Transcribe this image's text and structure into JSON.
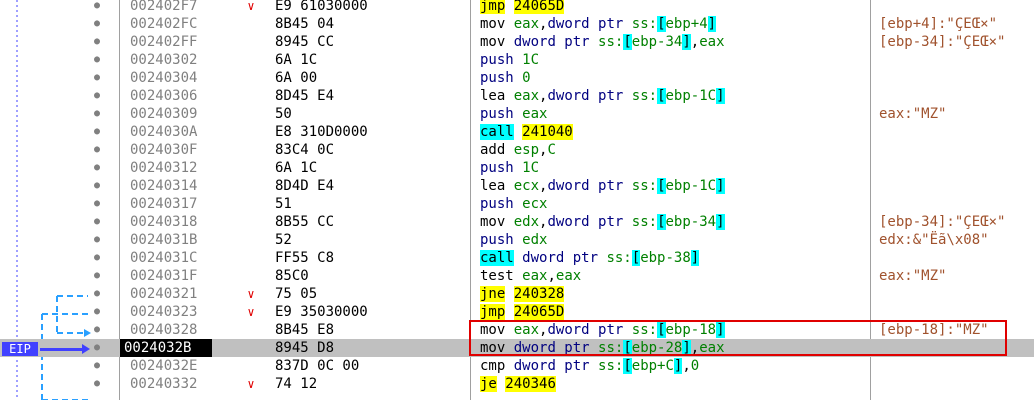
{
  "eip_label": "EIP",
  "rows": [
    {
      "addr": "002402F7",
      "arrow": "∨",
      "bytes": "E9 61030000",
      "mn": "jmp",
      "mn_kind": "jmp",
      "ops": [
        {
          "t": "24065D",
          "k": "jmpaddr"
        }
      ],
      "comment": ""
    },
    {
      "addr": "002402FC",
      "arrow": "",
      "bytes": "8B45 04",
      "mn": "mov",
      "mn_kind": "",
      "ops": [
        {
          "t": "eax",
          "k": "reg"
        },
        {
          "t": ",",
          "k": ""
        },
        {
          "t": "dword ptr ",
          "k": "kw"
        },
        {
          "t": "ss:",
          "k": "reg"
        },
        {
          "t": "[",
          "k": "br"
        },
        {
          "t": "ebp+4",
          "k": "reg"
        },
        {
          "t": "]",
          "k": "br"
        }
      ],
      "comment": "[ebp+4]:\"ÇEŒ×\""
    },
    {
      "addr": "002402FF",
      "arrow": "",
      "bytes": "8945 CC",
      "mn": "mov",
      "mn_kind": "",
      "ops": [
        {
          "t": "dword ptr ",
          "k": "kw"
        },
        {
          "t": "ss:",
          "k": "reg"
        },
        {
          "t": "[",
          "k": "br"
        },
        {
          "t": "ebp-34",
          "k": "reg"
        },
        {
          "t": "]",
          "k": "br"
        },
        {
          "t": ",",
          "k": ""
        },
        {
          "t": "eax",
          "k": "reg"
        }
      ],
      "comment": "[ebp-34]:\"ÇEŒ×\""
    },
    {
      "addr": "00240302",
      "arrow": "",
      "bytes": "6A 1C",
      "mn": "push",
      "mn_kind": "push",
      "ops": [
        {
          "t": "1C",
          "k": "num"
        }
      ],
      "comment": ""
    },
    {
      "addr": "00240304",
      "arrow": "",
      "bytes": "6A 00",
      "mn": "push",
      "mn_kind": "push",
      "ops": [
        {
          "t": "0",
          "k": "num"
        }
      ],
      "comment": ""
    },
    {
      "addr": "00240306",
      "arrow": "",
      "bytes": "8D45 E4",
      "mn": "lea",
      "mn_kind": "",
      "ops": [
        {
          "t": "eax",
          "k": "reg"
        },
        {
          "t": ",",
          "k": ""
        },
        {
          "t": "dword ptr ",
          "k": "kw"
        },
        {
          "t": "ss:",
          "k": "reg"
        },
        {
          "t": "[",
          "k": "br"
        },
        {
          "t": "ebp-1C",
          "k": "reg"
        },
        {
          "t": "]",
          "k": "br"
        }
      ],
      "comment": ""
    },
    {
      "addr": "00240309",
      "arrow": "",
      "bytes": "50",
      "mn": "push",
      "mn_kind": "push",
      "ops": [
        {
          "t": "eax",
          "k": "reg"
        }
      ],
      "comment": "eax:\"MZ\""
    },
    {
      "addr": "0024030A",
      "arrow": "",
      "bytes": "E8 310D0000",
      "mn": "call",
      "mn_kind": "call",
      "ops": [
        {
          "t": "241040",
          "k": "jmpaddr"
        }
      ],
      "comment": ""
    },
    {
      "addr": "0024030F",
      "arrow": "",
      "bytes": "83C4 0C",
      "mn": "add",
      "mn_kind": "",
      "ops": [
        {
          "t": "esp",
          "k": "reg"
        },
        {
          "t": ",",
          "k": ""
        },
        {
          "t": "C",
          "k": "num"
        }
      ],
      "comment": ""
    },
    {
      "addr": "00240312",
      "arrow": "",
      "bytes": "6A 1C",
      "mn": "push",
      "mn_kind": "push",
      "ops": [
        {
          "t": "1C",
          "k": "num"
        }
      ],
      "comment": ""
    },
    {
      "addr": "00240314",
      "arrow": "",
      "bytes": "8D4D E4",
      "mn": "lea",
      "mn_kind": "",
      "ops": [
        {
          "t": "ecx",
          "k": "reg"
        },
        {
          "t": ",",
          "k": ""
        },
        {
          "t": "dword ptr ",
          "k": "kw"
        },
        {
          "t": "ss:",
          "k": "reg"
        },
        {
          "t": "[",
          "k": "br"
        },
        {
          "t": "ebp-1C",
          "k": "reg"
        },
        {
          "t": "]",
          "k": "br"
        }
      ],
      "comment": ""
    },
    {
      "addr": "00240317",
      "arrow": "",
      "bytes": "51",
      "mn": "push",
      "mn_kind": "push",
      "ops": [
        {
          "t": "ecx",
          "k": "reg"
        }
      ],
      "comment": ""
    },
    {
      "addr": "00240318",
      "arrow": "",
      "bytes": "8B55 CC",
      "mn": "mov",
      "mn_kind": "",
      "ops": [
        {
          "t": "edx",
          "k": "reg"
        },
        {
          "t": ",",
          "k": ""
        },
        {
          "t": "dword ptr ",
          "k": "kw"
        },
        {
          "t": "ss:",
          "k": "reg"
        },
        {
          "t": "[",
          "k": "br"
        },
        {
          "t": "ebp-34",
          "k": "reg"
        },
        {
          "t": "]",
          "k": "br"
        }
      ],
      "comment": "[ebp-34]:\"ÇEŒ×\""
    },
    {
      "addr": "0024031B",
      "arrow": "",
      "bytes": "52",
      "mn": "push",
      "mn_kind": "push",
      "ops": [
        {
          "t": "edx",
          "k": "reg"
        }
      ],
      "comment": "edx:&\"Ëã\\x08\""
    },
    {
      "addr": "0024031C",
      "arrow": "",
      "bytes": "FF55 C8",
      "mn": "call",
      "mn_kind": "call",
      "ops": [
        {
          "t": "dword ptr ",
          "k": "kw"
        },
        {
          "t": "ss:",
          "k": "reg"
        },
        {
          "t": "[",
          "k": "br"
        },
        {
          "t": "ebp-38",
          "k": "reg"
        },
        {
          "t": "]",
          "k": "br"
        }
      ],
      "comment": ""
    },
    {
      "addr": "0024031F",
      "arrow": "",
      "bytes": "85C0",
      "mn": "test",
      "mn_kind": "",
      "ops": [
        {
          "t": "eax",
          "k": "reg"
        },
        {
          "t": ",",
          "k": ""
        },
        {
          "t": "eax",
          "k": "reg"
        }
      ],
      "comment": "eax:\"MZ\""
    },
    {
      "addr": "00240321",
      "arrow": "∨",
      "bytes": "75 05",
      "mn": "jne",
      "mn_kind": "jmp",
      "ops": [
        {
          "t": "240328",
          "k": "jmpaddr"
        }
      ],
      "comment": ""
    },
    {
      "addr": "00240323",
      "arrow": "∨",
      "bytes": "E9 35030000",
      "mn": "jmp",
      "mn_kind": "jmp",
      "ops": [
        {
          "t": "24065D",
          "k": "jmpaddr"
        }
      ],
      "comment": ""
    },
    {
      "addr": "00240328",
      "arrow": "",
      "bytes": "8B45 E8",
      "mn": "mov",
      "mn_kind": "",
      "ops": [
        {
          "t": "eax",
          "k": "reg"
        },
        {
          "t": ",",
          "k": ""
        },
        {
          "t": "dword ptr ",
          "k": "kw"
        },
        {
          "t": "ss:",
          "k": "reg"
        },
        {
          "t": "[",
          "k": "br"
        },
        {
          "t": "ebp-18",
          "k": "reg"
        },
        {
          "t": "]",
          "k": "br"
        }
      ],
      "comment": "[ebp-18]:\"MZ\""
    },
    {
      "addr": "0024032B",
      "arrow": "",
      "bytes": "8945 D8",
      "mn": "mov",
      "mn_kind": "",
      "ops": [
        {
          "t": "dword ptr ",
          "k": "kw"
        },
        {
          "t": "ss:",
          "k": "reg"
        },
        {
          "t": "[",
          "k": "br"
        },
        {
          "t": "ebp-28",
          "k": "reg"
        },
        {
          "t": "]",
          "k": "br"
        },
        {
          "t": ",",
          "k": ""
        },
        {
          "t": "eax",
          "k": "reg"
        }
      ],
      "comment": "",
      "current": true
    },
    {
      "addr": "0024032E",
      "arrow": "",
      "bytes": "837D 0C 00",
      "mn": "cmp",
      "mn_kind": "",
      "ops": [
        {
          "t": "dword ptr ",
          "k": "kw"
        },
        {
          "t": "ss:",
          "k": "reg"
        },
        {
          "t": "[",
          "k": "br"
        },
        {
          "t": "ebp+C",
          "k": "reg"
        },
        {
          "t": "]",
          "k": "br"
        },
        {
          "t": ",",
          "k": ""
        },
        {
          "t": "0",
          "k": "num"
        }
      ],
      "comment": ""
    },
    {
      "addr": "00240332",
      "arrow": "∨",
      "bytes": "74 12",
      "mn": "je",
      "mn_kind": "jmp",
      "ops": [
        {
          "t": "240346",
          "k": "jmpaddr"
        }
      ],
      "comment": ""
    }
  ]
}
